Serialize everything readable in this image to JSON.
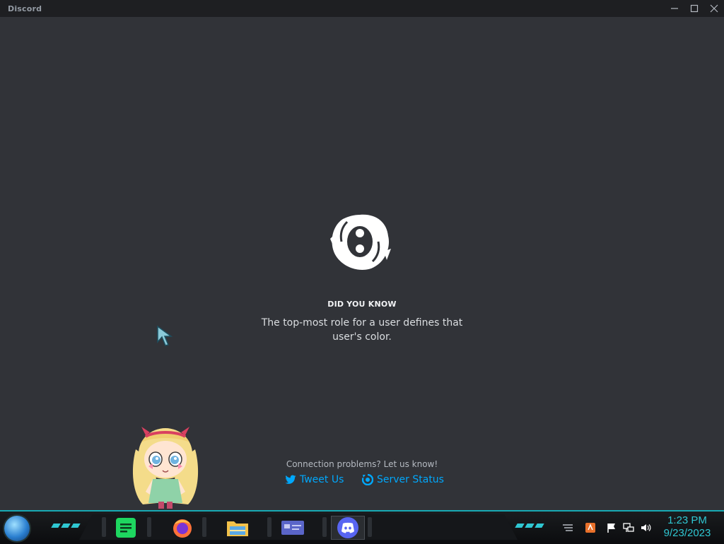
{
  "window": {
    "title": "Discord"
  },
  "loading": {
    "heading": "DID YOU KNOW",
    "tip": "The top-most role for a user defines that user's color."
  },
  "footer": {
    "connection_text": "Connection problems? Let us know!",
    "tweet_label": "Tweet Us",
    "status_label": "Server Status"
  },
  "taskbar": {
    "apps": [
      {
        "name": "spotify-icon"
      },
      {
        "name": "firefox-icon"
      },
      {
        "name": "file-explorer-icon"
      },
      {
        "name": "card-app-icon"
      },
      {
        "name": "discord-icon"
      }
    ],
    "clock": {
      "time": "1:23 PM",
      "date": "9/23/2023"
    }
  },
  "colors": {
    "accent": "#2fc7d2",
    "link": "#00a8fc",
    "background": "#313338"
  }
}
